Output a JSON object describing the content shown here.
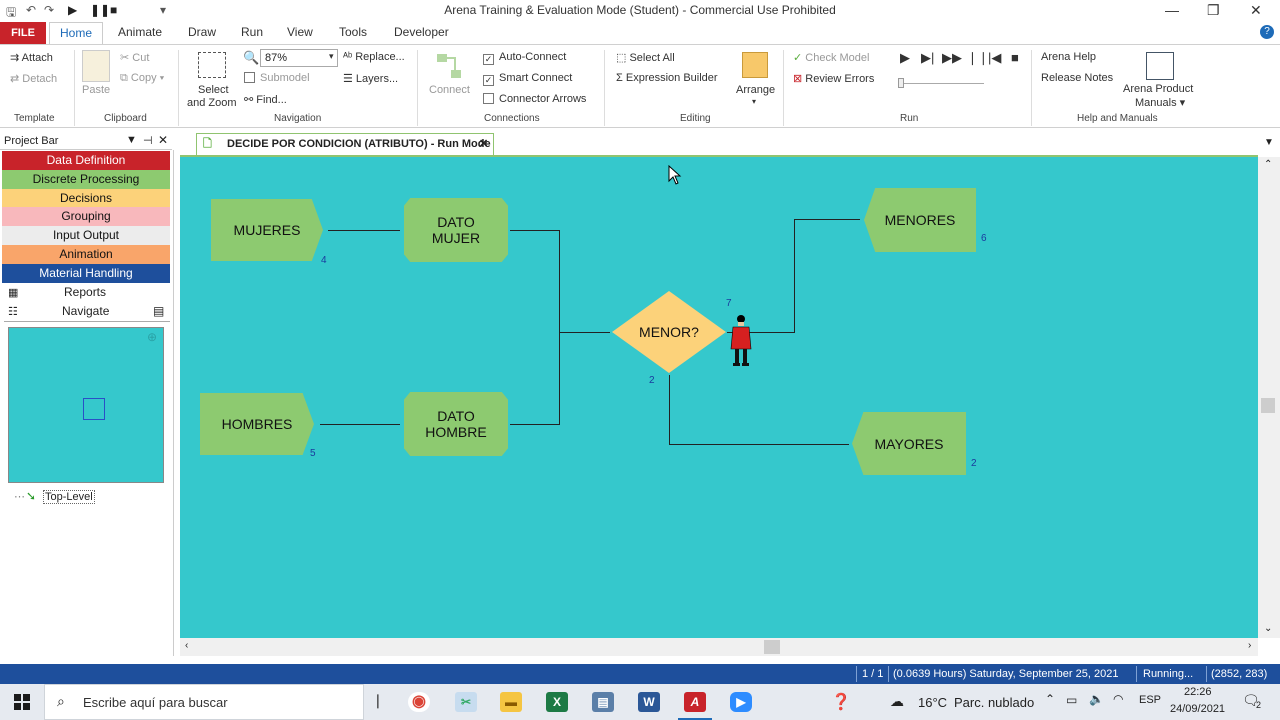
{
  "window": {
    "title": "Arena Training & Evaluation Mode (Student) - Commercial Use Prohibited",
    "minimize": "—",
    "restore": "❐",
    "close": "✕"
  },
  "menu": {
    "file": "FILE",
    "tabs": [
      "Home",
      "Animate",
      "Draw",
      "Run",
      "View",
      "Tools",
      "Developer"
    ]
  },
  "ribbon": {
    "template": {
      "attach": "Attach",
      "detach": "Detach",
      "group": "Template"
    },
    "clipboard": {
      "paste": "Paste",
      "cut": "Cut",
      "copy": "Copy",
      "group": "Clipboard"
    },
    "navigation": {
      "select_zoom_1": "Select",
      "select_zoom_2": "and Zoom",
      "zoom": "87%",
      "submodel": "Submodel",
      "find": "Find...",
      "replace": "Replace...",
      "layers": "Layers...",
      "group": "Navigation"
    },
    "connections": {
      "connect": "Connect",
      "auto_connect": "Auto-Connect",
      "smart_connect": "Smart Connect",
      "connector_arrows": "Connector Arrows",
      "auto_checked": true,
      "smart_checked": true,
      "arrows_checked": false,
      "group": "Connections"
    },
    "editing": {
      "select_all": "Select All",
      "expression_builder": "Expression Builder",
      "arrange": "Arrange",
      "group": "Editing"
    },
    "run": {
      "check_model": "Check Model",
      "review_errors": "Review Errors",
      "group": "Run"
    },
    "help": {
      "arena_help": "Arena Help",
      "release_notes": "Release Notes",
      "product_manuals_1": "Arena Product",
      "product_manuals_2": "Manuals",
      "group": "Help and Manuals"
    }
  },
  "project_bar": {
    "title": "Project Bar",
    "panels": [
      {
        "label": "Data Definition",
        "bg": "#c8232a",
        "fg": "#ffffff"
      },
      {
        "label": "Discrete Processing",
        "bg": "#8dca70",
        "fg": "#111111"
      },
      {
        "label": "Decisions",
        "bg": "#fcd27a",
        "fg": "#111111"
      },
      {
        "label": "Grouping",
        "bg": "#f8b8bc",
        "fg": "#111111"
      },
      {
        "label": "Input Output",
        "bg": "#ececec",
        "fg": "#111111"
      },
      {
        "label": "Animation",
        "bg": "#f9a56a",
        "fg": "#111111"
      },
      {
        "label": "Material Handling",
        "bg": "#1e4f9c",
        "fg": "#ffffff"
      }
    ],
    "reports": "Reports",
    "navigate": "Navigate",
    "top_level": "Top-Level"
  },
  "document_tab": {
    "label": "DECIDE POR CONDICION (ATRIBUTO) - Run Mode",
    "close": "✕"
  },
  "model": {
    "create_1": {
      "label": "MUJERES",
      "count": "4"
    },
    "assign_1": {
      "label1": "DATO",
      "label2": "MUJER"
    },
    "create_2": {
      "label": "HOMBRES",
      "count": "5"
    },
    "assign_2": {
      "label1": "DATO",
      "label2": "HOMBRE"
    },
    "decide": {
      "label": "MENOR?",
      "count_true": "7",
      "count_false": "2"
    },
    "dispose_1": {
      "label": "MENORES",
      "count": "6"
    },
    "dispose_2": {
      "label": "MAYORES",
      "count": "2"
    }
  },
  "status": {
    "page": "1 / 1",
    "time": "(0.0639 Hours) Saturday, September 25, 2021",
    "state": "Running...",
    "coords": "(2852, 283)"
  },
  "taskbar": {
    "search": "Escribe aquí para buscar",
    "temp": "16°C",
    "weather": "Parc. nublado",
    "lang": "ESP",
    "time": "22:26",
    "date": "24/09/2021",
    "notif": "2"
  },
  "colors": {
    "canvas": "#35c8cc",
    "process": "#8dca70",
    "decision": "#fcd27a",
    "statusbar": "#1e4f9c"
  }
}
